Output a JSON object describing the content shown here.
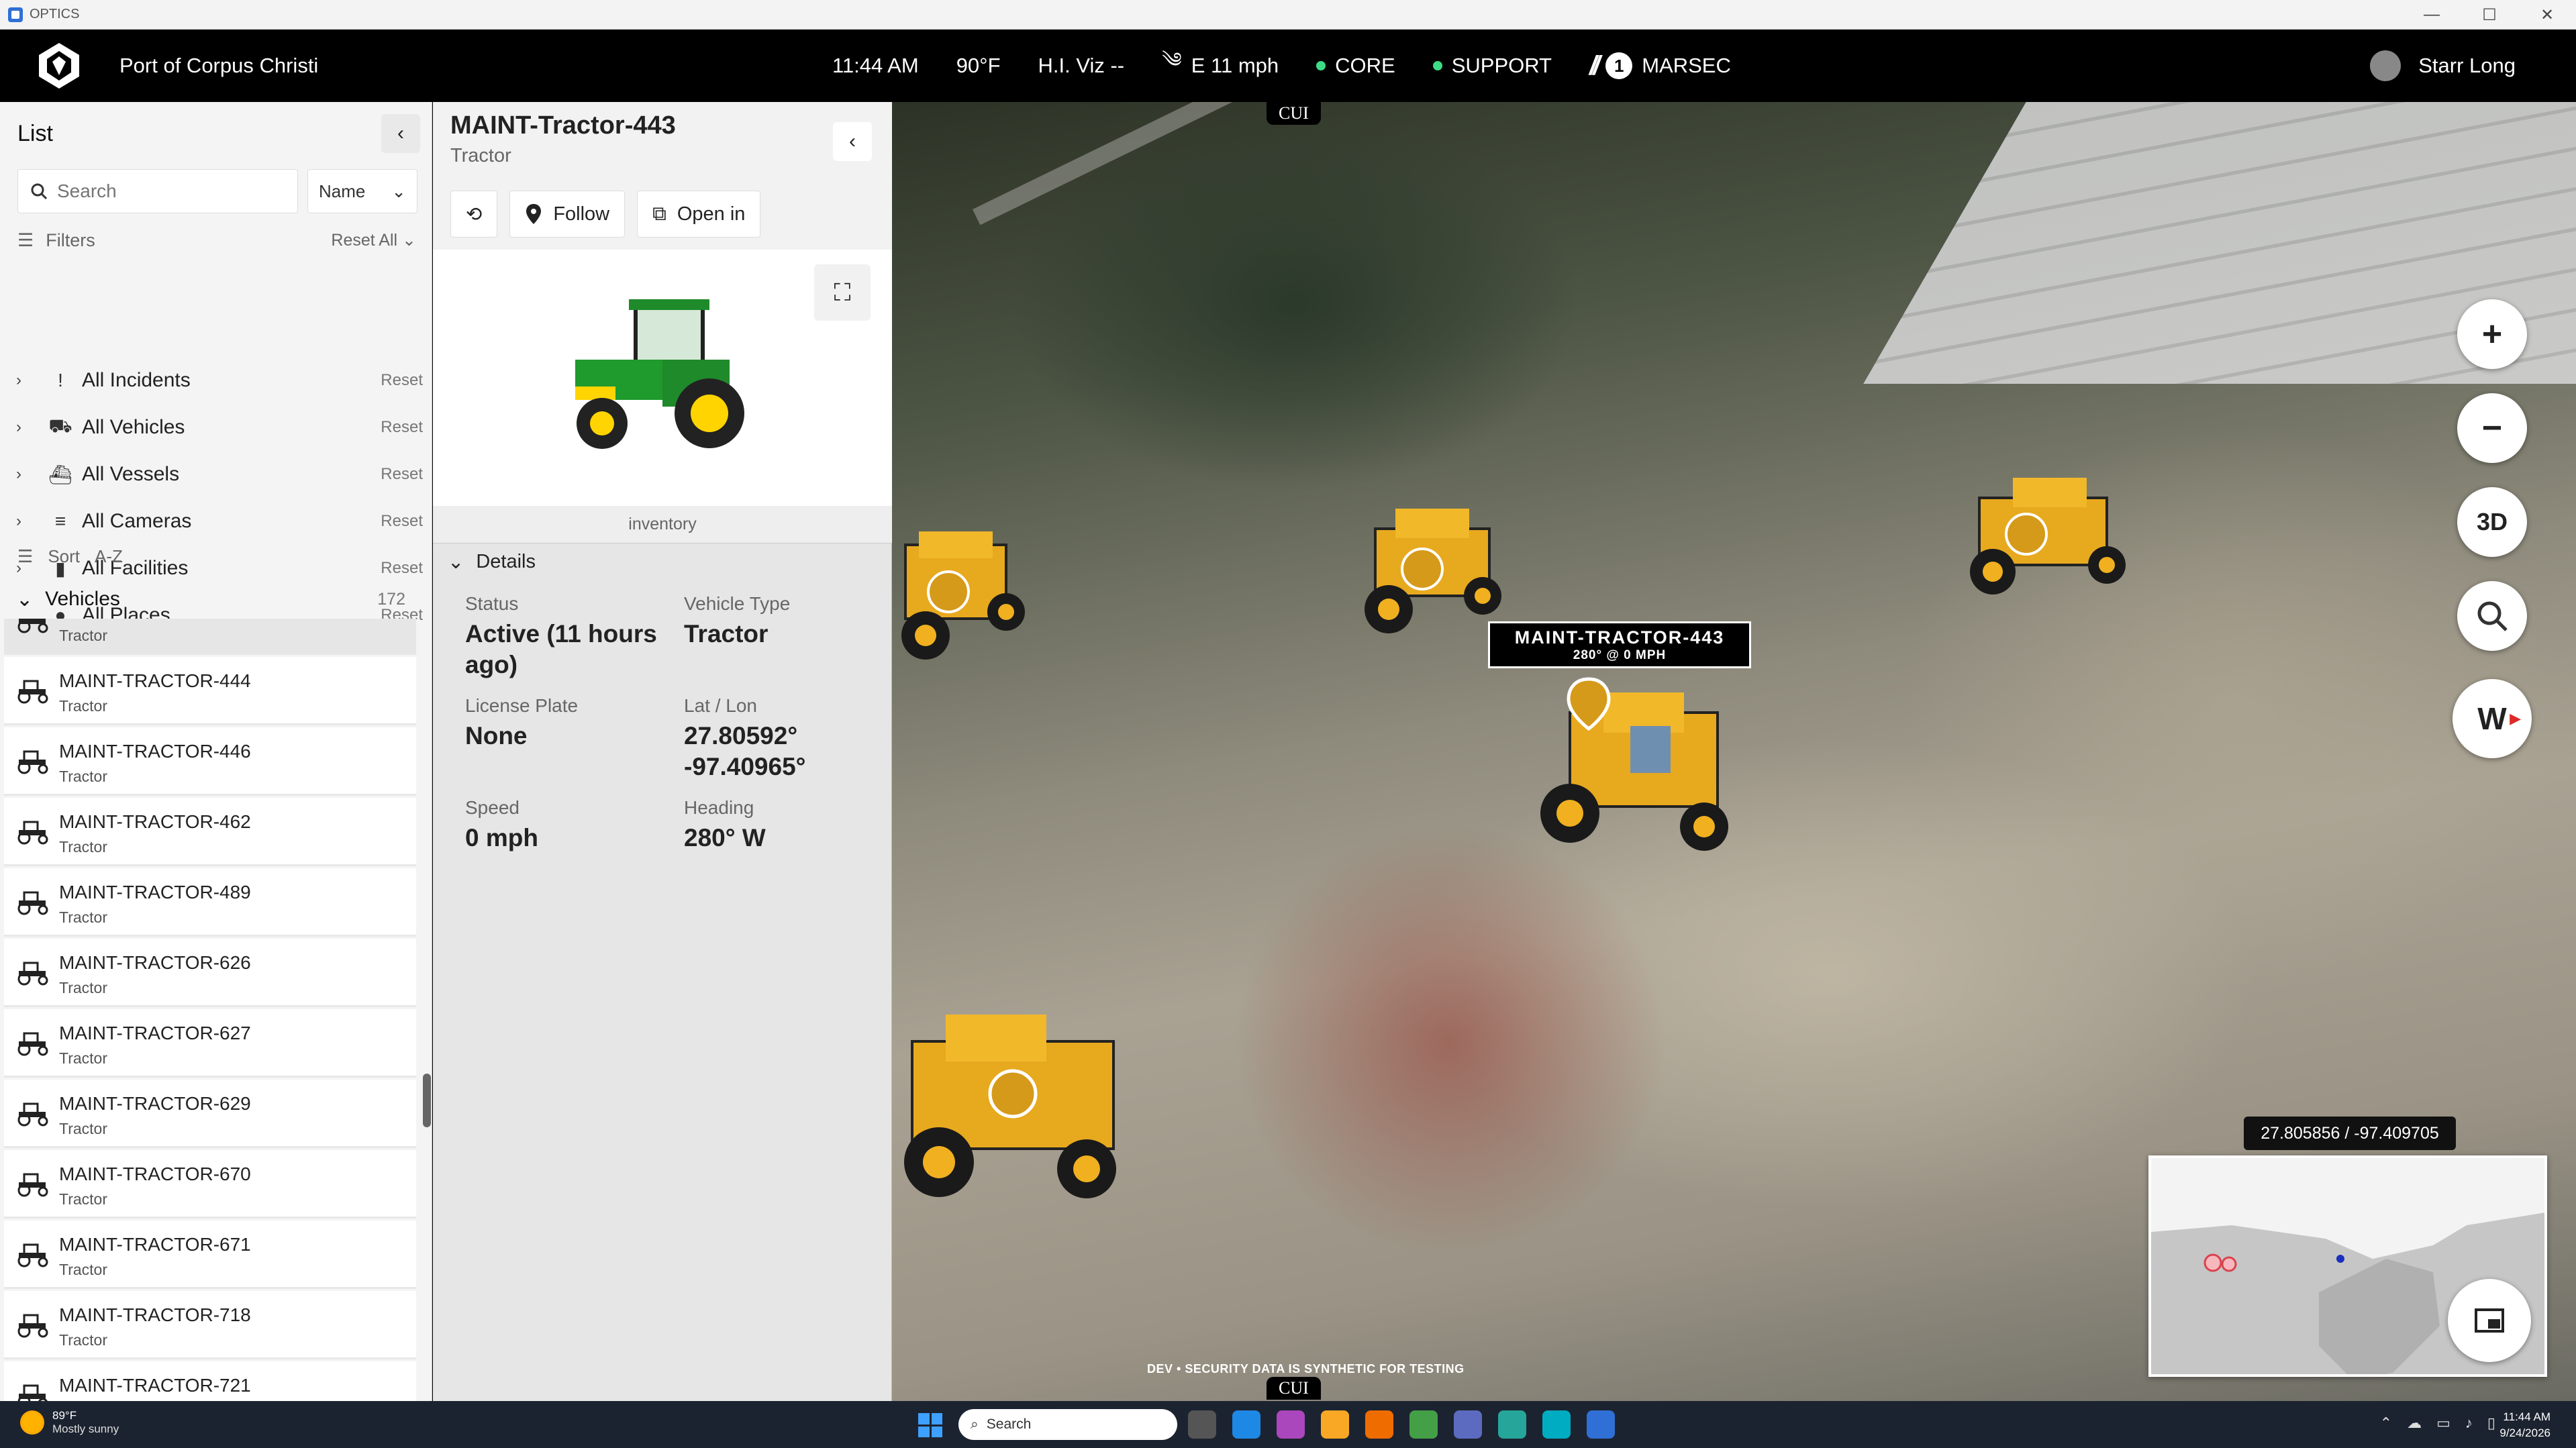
{
  "window": {
    "title": "OPTICS",
    "controls": [
      "—",
      "☐",
      "✕"
    ]
  },
  "header": {
    "port": "Port of Corpus Christi",
    "time": "11:44 AM",
    "temp": "90°F",
    "hiviz": "H.I. Viz --",
    "wind": "E 11 mph",
    "core": "CORE",
    "support": "SUPPORT",
    "marsec_level": "1",
    "marsec": "MARSEC",
    "user": "Starr Long",
    "status_color": "#3ddc84"
  },
  "list": {
    "title": "List",
    "search_placeholder": "Search",
    "sort_select": "Name",
    "filters_label": "Filters",
    "reset_all": "Reset All",
    "filters": [
      {
        "label": "All Incidents",
        "icon": "exclamation-icon",
        "reset": "Reset"
      },
      {
        "label": "All Vehicles",
        "icon": "truck-icon",
        "reset": "Reset"
      },
      {
        "label": "All Vessels",
        "icon": "ship-icon",
        "reset": "Reset"
      },
      {
        "label": "All Cameras",
        "icon": "camera-icon",
        "reset": "Reset"
      },
      {
        "label": "All Facilities",
        "icon": "building-icon",
        "reset": "Reset"
      },
      {
        "label": "All Places",
        "icon": "pin-icon",
        "reset": "Reset"
      }
    ],
    "sort_label": "Sort",
    "sort_value": "A-Z",
    "group_label": "Vehicles",
    "group_count": "172",
    "vehicles": [
      {
        "name": "",
        "type": "Tractor"
      },
      {
        "name": "MAINT-TRACTOR-444",
        "type": "Tractor"
      },
      {
        "name": "MAINT-TRACTOR-446",
        "type": "Tractor"
      },
      {
        "name": "MAINT-TRACTOR-462",
        "type": "Tractor"
      },
      {
        "name": "MAINT-TRACTOR-489",
        "type": "Tractor"
      },
      {
        "name": "MAINT-TRACTOR-626",
        "type": "Tractor"
      },
      {
        "name": "MAINT-TRACTOR-627",
        "type": "Tractor"
      },
      {
        "name": "MAINT-TRACTOR-629",
        "type": "Tractor"
      },
      {
        "name": "MAINT-TRACTOR-670",
        "type": "Tractor"
      },
      {
        "name": "MAINT-TRACTOR-671",
        "type": "Tractor"
      },
      {
        "name": "MAINT-TRACTOR-718",
        "type": "Tractor"
      },
      {
        "name": "MAINT-TRACTOR-721",
        "type": ""
      }
    ]
  },
  "detail": {
    "title": "MAINT-Tractor-443",
    "subtitle": "Tractor",
    "follow": "Follow",
    "open_in": "Open in",
    "image_caption": "inventory",
    "details_label": "Details",
    "status_label": "Status",
    "status_value": "Active (11 hours ago)",
    "vehicle_type_label": "Vehicle Type",
    "vehicle_type_value": "Tractor",
    "plate_label": "License Plate",
    "plate_value": "None",
    "latlon_label": "Lat / Lon",
    "lat_value": "27.80592°",
    "lon_value": "-97.40965°",
    "speed_label": "Speed",
    "speed_value": "0 mph",
    "heading_label": "Heading",
    "heading_value": "280° W"
  },
  "map": {
    "cui_top": "CUI",
    "cui_bottom": "CUI",
    "selected_label": "MAINT-TRACTOR-443",
    "selected_sub": "280° @ 0 MPH",
    "zoom_in": "+",
    "zoom_out": "−",
    "mode_3d": "3D",
    "compass": "W",
    "coord_readout": "27.805856 / -97.409705",
    "dev_note": "DEV • SECURITY DATA IS SYNTHETIC FOR TESTING",
    "tractor_color": "#e7a91e"
  },
  "taskbar": {
    "weather_temp": "89°F",
    "weather_desc": "Mostly sunny",
    "search_placeholder": "Search",
    "clock_time": "11:44 AM",
    "clock_date": "9/24/2026"
  }
}
